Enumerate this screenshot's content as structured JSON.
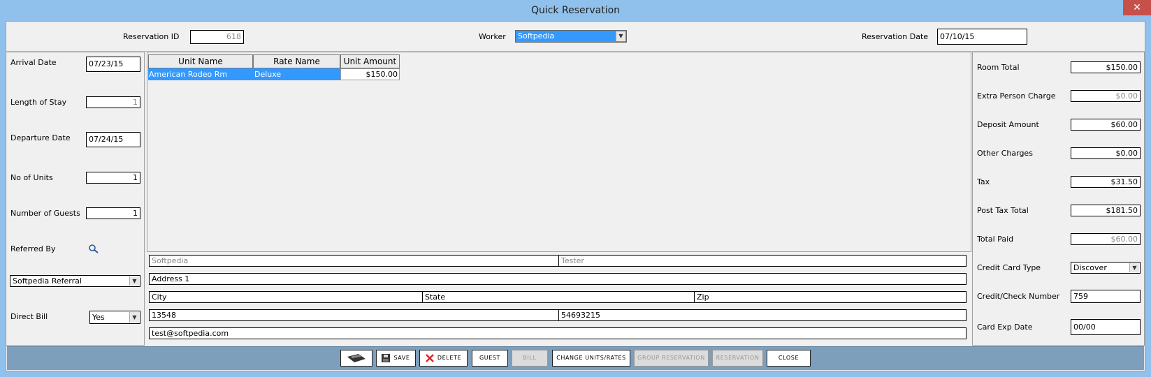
{
  "window": {
    "title": "Quick Reservation",
    "close_glyph": "✕"
  },
  "header": {
    "reservation_id_label": "Reservation ID",
    "reservation_id_value": "618",
    "worker_label": "Worker",
    "worker_value": "Softpedia",
    "reservation_date_label": "Reservation Date",
    "reservation_date_value": "07/10/15"
  },
  "left": {
    "arrival_label": "Arrival Date",
    "arrival_value": "07/23/15",
    "los_label": "Length of Stay",
    "los_value": "1",
    "departure_label": "Departure Date",
    "departure_value": "07/24/15",
    "units_label": "No of Units",
    "units_value": "1",
    "guests_label": "Number of Guests",
    "guests_value": "1",
    "referred_label": "Referred By",
    "referral_value": "Softpedia Referral",
    "direct_bill_label": "Direct Bill",
    "direct_bill_value": "Yes"
  },
  "units_table": {
    "columns": [
      "Unit Name",
      "Rate Name",
      "Unit Amount"
    ],
    "rows": [
      [
        "American Rodeo Rm",
        "Deluxe",
        "$150.00"
      ]
    ]
  },
  "guest": {
    "first_name": "Softpedia",
    "last_name": "Tester",
    "address": "Address 1",
    "city": "City",
    "state": "State",
    "zip": "Zip",
    "phone1": "13548",
    "phone2": "54693215",
    "email": "test@softpedia.com"
  },
  "totals": {
    "room_total_label": "Room Total",
    "room_total": "$150.00",
    "extra_person_label": "Extra Person Charge",
    "extra_person": "$0.00",
    "deposit_label": "Deposit Amount",
    "deposit": "$60.00",
    "other_label": "Other Charges",
    "other": "$0.00",
    "tax_label": "Tax",
    "tax": "$31.50",
    "post_tax_label": "Post Tax Total",
    "post_tax": "$181.50",
    "paid_label": "Total Paid",
    "paid": "$60.00",
    "cc_type_label": "Credit Card Type",
    "cc_type": "Discover",
    "cc_number_label": "Credit/Check Number",
    "cc_number": "759",
    "exp_label": "Card Exp Date",
    "exp": "00/00"
  },
  "buttons": {
    "save": "SAVE",
    "delete": "DELETE",
    "guest": "GUEST",
    "bill": "BILL",
    "change": "CHANGE UNITS/RATES",
    "group": "GROUP RESERVATION",
    "reservation": "RESERVATION",
    "close": "CLOSE"
  },
  "colors": {
    "window_bg": "#8fc1ec",
    "selection": "#3399ff",
    "button_bar": "#7e9fbc"
  }
}
